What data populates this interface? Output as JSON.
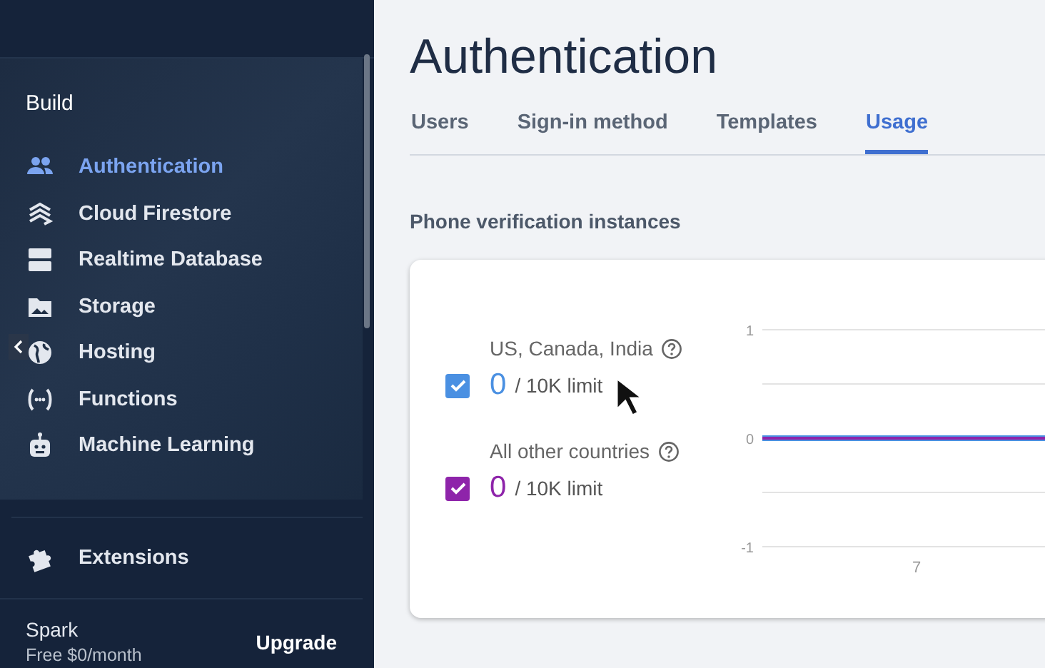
{
  "sidebar": {
    "section_title": "Build",
    "items": [
      {
        "label": "Authentication",
        "selected": true
      },
      {
        "label": "Cloud Firestore",
        "selected": false
      },
      {
        "label": "Realtime Database",
        "selected": false
      },
      {
        "label": "Storage",
        "selected": false
      },
      {
        "label": "Hosting",
        "selected": false
      },
      {
        "label": "Functions",
        "selected": false
      },
      {
        "label": "Machine Learning",
        "selected": false
      }
    ],
    "extensions": {
      "label": "Extensions"
    },
    "plan": {
      "name": "Spark",
      "price": "Free $0/month",
      "action": "Upgrade"
    }
  },
  "page": {
    "title": "Authentication",
    "tabs": [
      {
        "label": "Users",
        "selected": false
      },
      {
        "label": "Sign-in method",
        "selected": false
      },
      {
        "label": "Templates",
        "selected": false
      },
      {
        "label": "Usage",
        "selected": true
      }
    ],
    "section_title": "Phone verification instances",
    "legend": [
      {
        "label": "US, Canada, India",
        "value": "0",
        "limit": "/ 10K limit",
        "checked": true,
        "color": "#4a90e2"
      },
      {
        "label": "All other countries",
        "value": "0",
        "limit": "/ 10K limit",
        "checked": true,
        "color": "#8e24aa"
      }
    ],
    "chart": {
      "y_labels": [
        "1",
        "0",
        "-1"
      ],
      "x_labels": [
        "7"
      ]
    }
  }
}
